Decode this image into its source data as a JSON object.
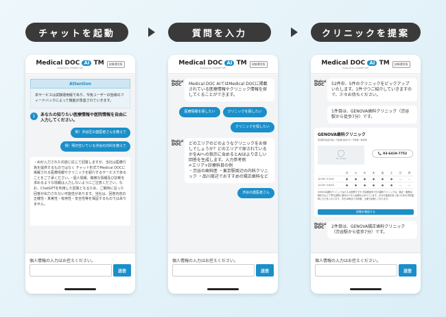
{
  "steps": [
    {
      "label": "チャットを起動"
    },
    {
      "label": "質問を入力"
    },
    {
      "label": "クリニックを提案"
    }
  ],
  "header": {
    "logo_main": "Medical DOC",
    "logo_ai": "AI",
    "logo_tm": "TM",
    "logo_sub": "Powered by ChatGPT API",
    "badge": "試験運用版",
    "bot_logo_top": "Medical",
    "bot_logo_bottom": "DOC"
  },
  "footer": {
    "note": "個人情報の入力はお控えください。",
    "send_label": "送信"
  },
  "phone1": {
    "attention_title": "Attention",
    "attention_body": "本サービスは試験運用版であり、今後ユーザーの皆様のフィードバックによって機能が改善されていきます。",
    "question_num": "1",
    "question_text": "あなたの知りたい医療情報や医院情報を自由に入力してください。",
    "example1": "例）渋谷区の歯医者さんを教えて",
    "example2": "例）明日空いている渋谷の内科を教えて",
    "disclaimer": "・AIが入力された内容に応じて回答しますが、当社は医療行為を提供するものではなく チャット形式でMedical DOCに掲載される医療情報やクリニックを紹介するサービスであることをご了承ください。・個人情報、機微な情報及び診断を求めるような情報は入力しないようにご注意ください。なお、ChatGPTを利用した回答となるため、ご期待に沿った回答が出力されない可能性があります。当社は、回答内容の正確性・真実性・有用性・安全性等を保証するものではありません。"
  },
  "phone2": {
    "bot_intro": "Medical DOC AIではMedical DOCに掲載されている医療情報やクリニック情報を探してくることができます。",
    "btn_medical": "医療情報を探したい",
    "btn_clinic": "クリニックを探したい",
    "user_pick": "クリニックを探したい",
    "bot_ask": "どのエリアのどのようなクリニックをお探しでしょうか？どのエリアで探されているかをAIへの指示に含めるとAIはより正しい回答を生成します。入力参考例",
    "bot_example_head": "✍エリア+診療科目の例",
    "bot_examples": "・渋谷の歯科医 ・東京駅周辺の内科クリニック ・品川周辺でおすすめの矯正歯科など",
    "user_input": "渋谷の歯医者さん"
  },
  "phone3": {
    "bot_result": "52件中、5件のクリニックをピックアップいたします。1件づつご紹介していきますので、少々お待ちください。",
    "bot_first": "1件目は、GENOVA歯科クリニック（渋谷駅から徒歩7分）です。",
    "clinic_name": "GENOVA歯科クリニック",
    "clinic_addr": "東京都渋谷区渋谷 / 渋谷駅 徒歩7分 / 予約制・駐車場",
    "clinic_img_label": "No Image",
    "phone_number": "03-6419-7752",
    "days": [
      "月",
      "火",
      "水",
      "木",
      "金",
      "土",
      "日",
      "祝"
    ],
    "hours": [
      {
        "time": "10:00〜13:00",
        "marks": [
          "●",
          "●",
          "●",
          "●",
          "●",
          "●",
          "—",
          "—"
        ]
      },
      {
        "time": "14:00〜18:00",
        "marks": [
          "●",
          "●",
          "●",
          "●",
          "●",
          "●",
          "—",
          "—"
        ]
      }
    ],
    "clinic_desc": "GENOVA歯科クリニックはどんな医院ですか 渋谷駅徒歩7分の歯科クリニックは、矯正・審美治療を中心に丁寧な説明と痛みの少ない治療を心がけています。お口の健康を長く保つための予防歯科にも力を入れており、平日18時までの診療、土曜も診療しております。",
    "detail_label": "詳細を確認する",
    "bot_second": "2件目は、GENOVA矯正歯科クリニック（渋谷駅から徒歩7分）です。"
  }
}
